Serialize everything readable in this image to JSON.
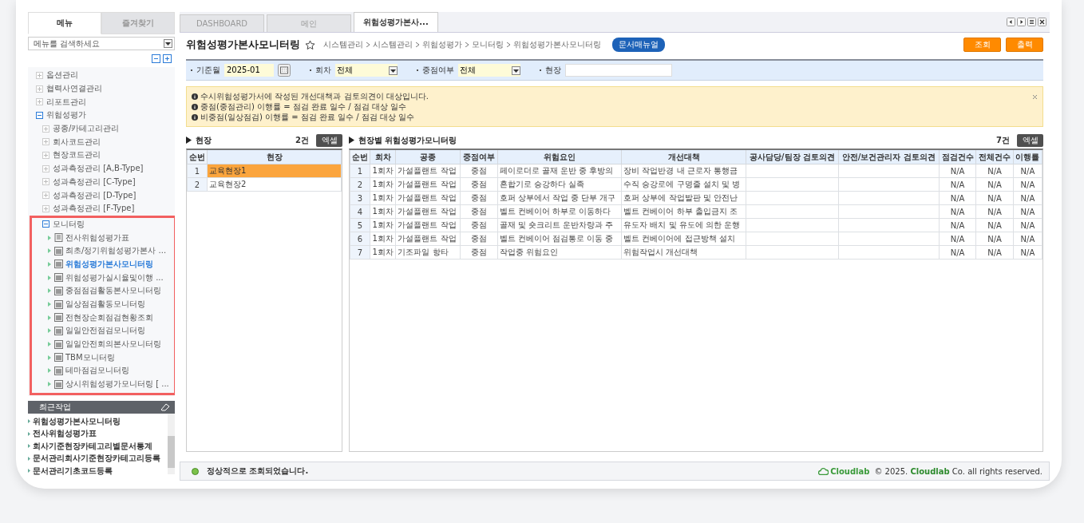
{
  "sidebar": {
    "tabs": [
      {
        "label": "메뉴",
        "selected": true
      },
      {
        "label": "즐겨찾기",
        "selected": false
      }
    ],
    "search": {
      "placeholder": "메뉴를 검색하세요"
    },
    "tree": [
      {
        "label": "옵션관리",
        "expanded": false
      },
      {
        "label": "협력사연결관리",
        "expanded": false
      },
      {
        "label": "리포트관리",
        "expanded": false
      },
      {
        "label": "위험성평가",
        "expanded": true,
        "children": [
          {
            "label": "공종/카테고리관리",
            "expanded": false
          },
          {
            "label": "회사코드관리",
            "expanded": false
          },
          {
            "label": "현장코드관리",
            "expanded": false
          },
          {
            "label": "성과측정관리 [A,B-Type]",
            "expanded": false
          },
          {
            "label": "성과측정관리 [C-Type]",
            "expanded": false
          },
          {
            "label": "성과측정관리 [D-Type]",
            "expanded": false
          },
          {
            "label": "성과측정관리 [F-Type]",
            "expanded": false
          },
          {
            "label": "모니터링",
            "expanded": true,
            "highlighted": true,
            "children": [
              {
                "label": "전사위험성평가표",
                "kind": "document",
                "selected": false
              },
              {
                "label": "최초/정기위험성평가본사 ...",
                "kind": "window",
                "selected": false
              },
              {
                "label": "위험성평가본사모니터링",
                "kind": "window",
                "selected": true
              },
              {
                "label": "위험성평가실시율및이행 ...",
                "kind": "window",
                "selected": false
              },
              {
                "label": "중점점검활동본사모니터링",
                "kind": "window",
                "selected": false
              },
              {
                "label": "일상점검활동모니터링",
                "kind": "window",
                "selected": false
              },
              {
                "label": "전현장순회점검현황조회",
                "kind": "window",
                "selected": false
              },
              {
                "label": "일일안전점검모니터링",
                "kind": "window",
                "selected": false
              },
              {
                "label": "일일안전회의본사모니터링",
                "kind": "window",
                "selected": false
              },
              {
                "label": "TBM모니터링",
                "kind": "window",
                "selected": false
              },
              {
                "label": "테마점검모니터링",
                "kind": "window",
                "selected": false
              },
              {
                "label": "상시위험성평가모니터링 [ ...",
                "kind": "window",
                "selected": false
              }
            ]
          }
        ]
      }
    ],
    "recent": {
      "title": "최근작업",
      "items": [
        "위험성평가본사모니터링",
        "전사위험성평가표",
        "회사기준현장카테고리별문서통계",
        "문서관리회사기준현장카테고리등록",
        "문서관리기초코드등록"
      ]
    }
  },
  "tabs": [
    {
      "label": "DASHBOARD",
      "selected": false
    },
    {
      "label": "메인",
      "selected": false
    },
    {
      "label": "위험성평가본사...",
      "selected": true
    }
  ],
  "page": {
    "title": "위험성평가본사모니터링",
    "breadcrumb": [
      "시스템관리",
      "시스템관리",
      "위험성평가",
      "모니터링",
      "위험성평가본사모니터링"
    ],
    "manual_button": "문서매뉴얼",
    "buttons": [
      "조회",
      "출력"
    ]
  },
  "filters": [
    {
      "kind": "month",
      "label": "기준월",
      "value": "2025-01"
    },
    {
      "kind": "select",
      "label": "회차",
      "value": "전체"
    },
    {
      "kind": "select",
      "label": "중점여부",
      "value": "전체"
    },
    {
      "kind": "text",
      "label": "현장"
    }
  ],
  "notice": [
    "수시위험성평가서에 작성된 개선대책과 검토의견이 대상입니다.",
    "중점(중점관리) 이행률 = 점검 완료 일수 / 점검 대상 일수",
    "비중점(일상점검) 이행률 = 점검 완료 일수 / 점검 대상 일수"
  ],
  "sites": {
    "title": "현장",
    "count": "2건",
    "excel": "엑셀",
    "columns": [
      "순번",
      "현장"
    ],
    "rows": [
      {
        "cells": [
          "1",
          "교육현장1"
        ],
        "selected": true
      },
      {
        "cells": [
          "2",
          "교육현장2"
        ],
        "selected": false
      }
    ]
  },
  "monitor": {
    "title": "현장별 위험성평가모니터링",
    "count": "7건",
    "excel": "엑셀",
    "columns": [
      "순번",
      "회차",
      "공종",
      "중점여부",
      "위험요인",
      "개선대책",
      "공사담당/팀장 검토의견",
      "안전/보건관리자 검토의견",
      "점검건수",
      "전체건수",
      "이행률"
    ],
    "rows": [
      [
        "1",
        "1회차",
        "가설플랜트 작업",
        "중점",
        "페이로더로 골재 운반 중 후방의",
        "장비 작업반경 내 근로자 통행금",
        null,
        null,
        "N/A",
        "N/A",
        "N/A"
      ],
      [
        "2",
        "1회차",
        "가설플랜트 작업",
        "중점",
        "혼합기로 승강하다 실족",
        "수직 승강로에 구명줄 설치 및 병",
        null,
        null,
        "N/A",
        "N/A",
        "N/A"
      ],
      [
        "3",
        "1회차",
        "가설플랜트 작업",
        "중점",
        "호퍼 상부에서 작업 중 단부 개구",
        "호퍼 상부에 작업발판 및 안전난",
        null,
        null,
        "N/A",
        "N/A",
        "N/A"
      ],
      [
        "4",
        "1회차",
        "가설플랜트 작업",
        "중점",
        "벨트 컨베이어 하부로 이동하다",
        "벨트 컨베이어 하부 출입금지 조",
        null,
        null,
        "N/A",
        "N/A",
        "N/A"
      ],
      [
        "5",
        "1회차",
        "가설플랜트 작업",
        "중점",
        "골재 및 숏크리트 운반차량과 주",
        "유도자 배치 및 유도에 의한 운행",
        null,
        null,
        "N/A",
        "N/A",
        "N/A"
      ],
      [
        "6",
        "1회차",
        "가설플랜트 작업",
        "중점",
        "벨트 컨베이어 점검통로 이동 중",
        "벨트 컨베이어에 접근방책 설치",
        null,
        null,
        "N/A",
        "N/A",
        "N/A"
      ],
      [
        "7",
        "1회차",
        "기조파일 항타",
        "중점",
        "작업중 위험요인",
        "위험작업시 개선대책",
        null,
        null,
        "N/A",
        "N/A",
        "N/A"
      ]
    ]
  },
  "status_bar": {
    "message": "정상적으로 조회되었습니다.",
    "logo": "Cloudlab",
    "copyright_prefix": "© 2025.",
    "company": "Cloudlab",
    "copyright_suffix": "Co. all rights reserved."
  }
}
